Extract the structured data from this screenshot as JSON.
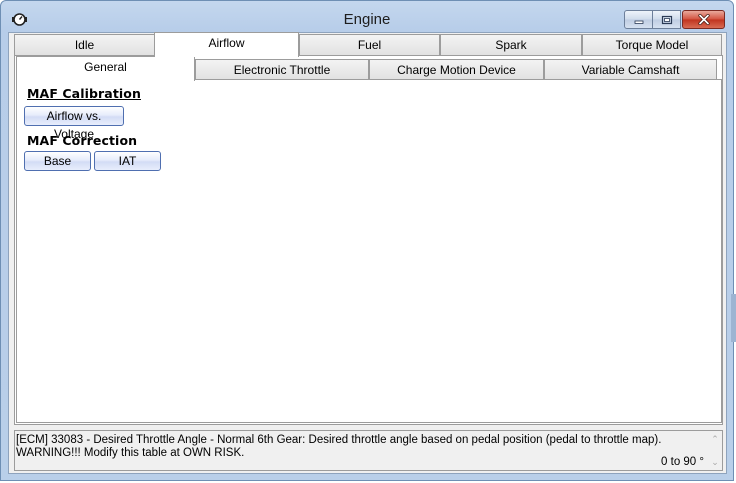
{
  "window": {
    "title": "Engine",
    "controls": [
      "minimize",
      "maximize",
      "close"
    ]
  },
  "outer_tabs": [
    {
      "label": "Idle",
      "active": false
    },
    {
      "label": "Airflow",
      "active": true
    },
    {
      "label": "Fuel",
      "active": false
    },
    {
      "label": "Spark",
      "active": false
    },
    {
      "label": "Torque Model",
      "active": false
    }
  ],
  "inner_tabs": [
    {
      "label": "General",
      "active": true
    },
    {
      "label": "Electronic Throttle",
      "active": false
    },
    {
      "label": "Charge Motion Device",
      "active": false
    },
    {
      "label": "Variable Camshaft",
      "active": false
    }
  ],
  "sections": {
    "maf_calibration": {
      "heading": "MAF Calibration",
      "buttons": [
        "Airflow vs. Voltage"
      ]
    },
    "maf_correction": {
      "heading": "MAF Correction",
      "buttons": [
        "Base",
        "IAT"
      ]
    }
  },
  "status": {
    "description": "[ECM] 33083 - Desired Throttle Angle - Normal 6th Gear: Desired throttle angle based on pedal position (pedal to throttle map). WARNING!!! Modify this table at OWN RISK.",
    "range": "0 to 90 °"
  },
  "icons": {
    "app": "gauge-icon",
    "minimize": "minimize-icon",
    "maximize": "maximize-icon",
    "close": "close-icon",
    "scroll_up": "chevron-up-icon",
    "scroll_down": "chevron-down-icon"
  },
  "colors": {
    "titlebar": "#b9cfe9",
    "close_button": "#c0331e",
    "button_border": "#4f6fb0"
  }
}
